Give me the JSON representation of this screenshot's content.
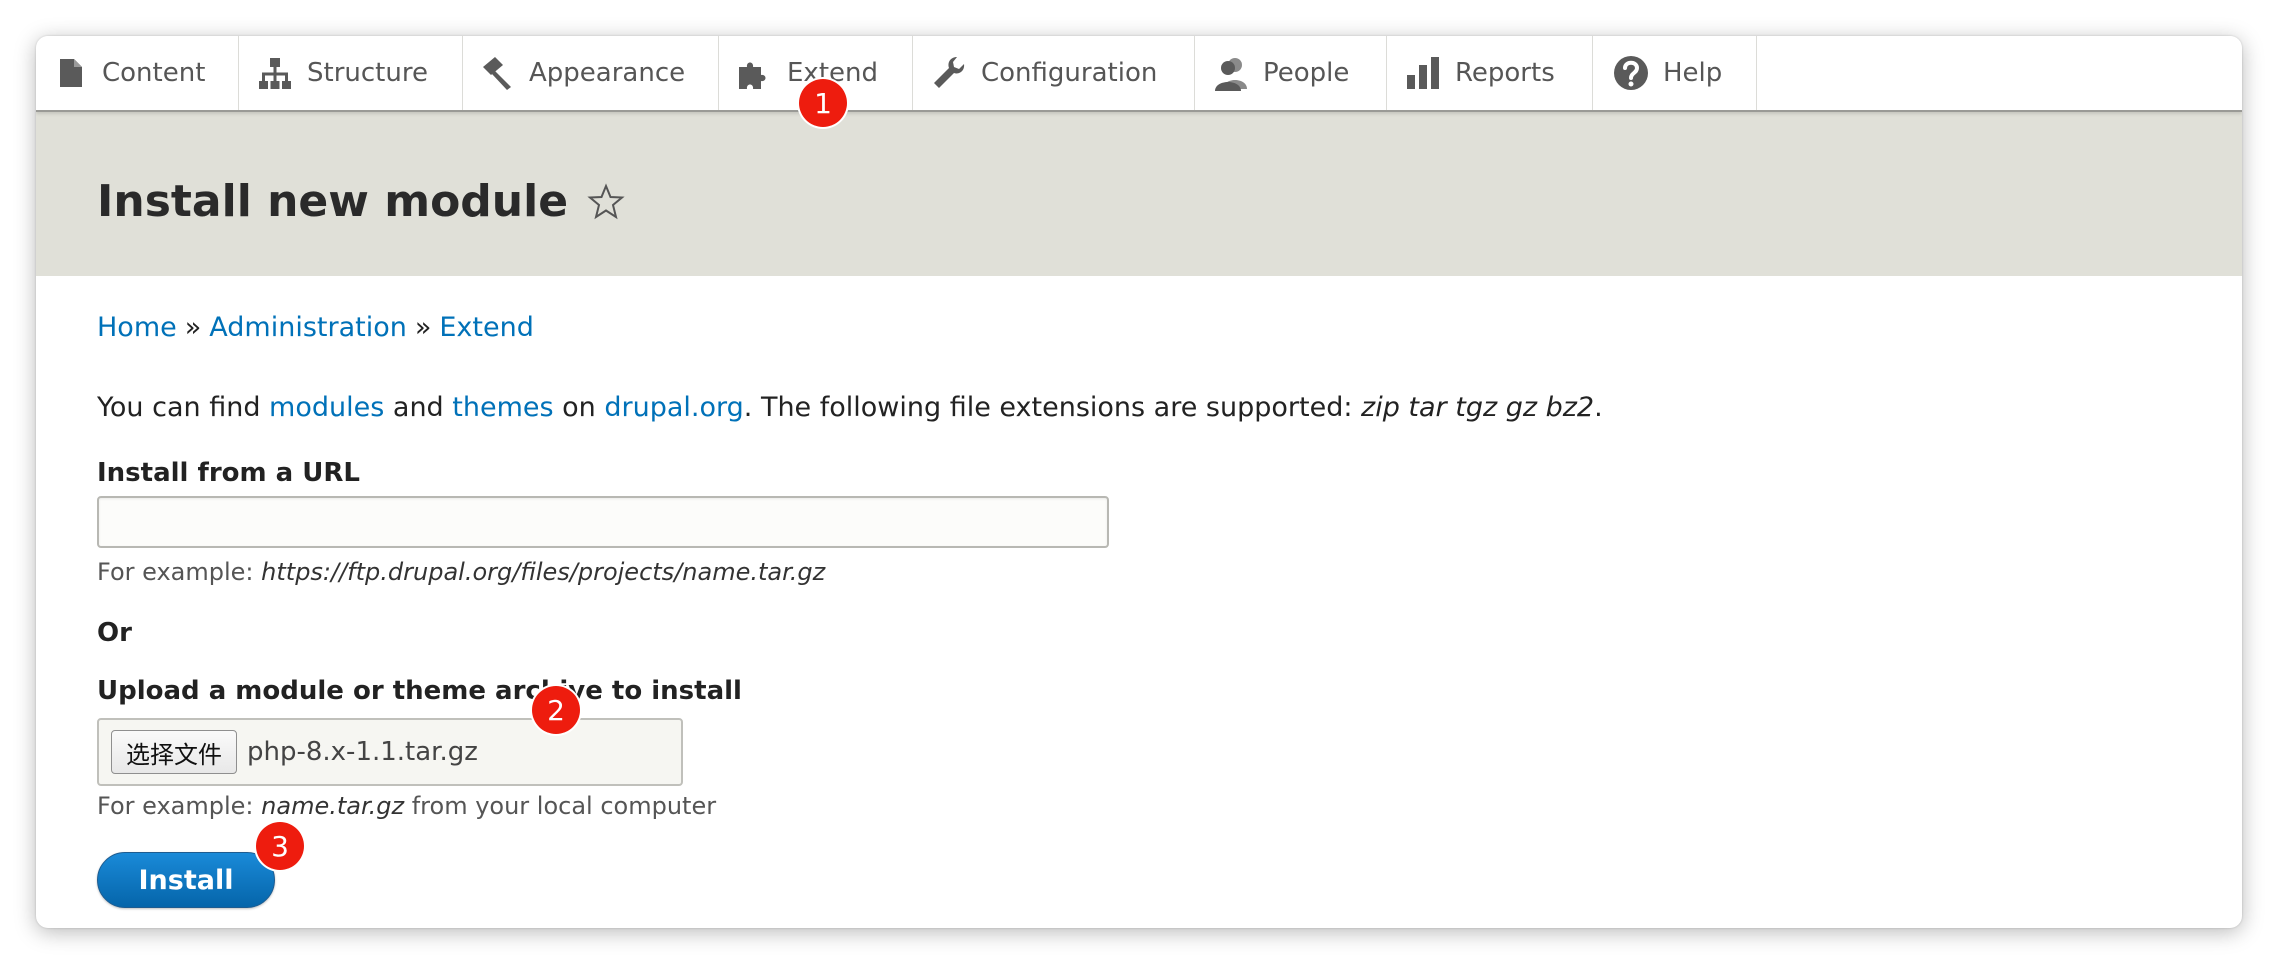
{
  "toolbar": {
    "items": [
      {
        "label": "Content",
        "icon": "document-icon"
      },
      {
        "label": "Structure",
        "icon": "sitemap-icon"
      },
      {
        "label": "Appearance",
        "icon": "paint-brush-icon"
      },
      {
        "label": "Extend",
        "icon": "puzzle-icon"
      },
      {
        "label": "Configuration",
        "icon": "wrench-icon"
      },
      {
        "label": "People",
        "icon": "people-icon"
      },
      {
        "label": "Reports",
        "icon": "bar-chart-icon"
      },
      {
        "label": "Help",
        "icon": "help-icon"
      }
    ]
  },
  "page": {
    "title": "Install new module"
  },
  "breadcrumb": {
    "items": [
      "Home",
      "Administration",
      "Extend"
    ],
    "separator": "»"
  },
  "intro": {
    "prefix": "You can find ",
    "link_modules": "modules",
    "and": " and ",
    "link_themes": "themes",
    "on": " on ",
    "link_drupal": "drupal.org",
    "middle": ". The following file extensions are supported: ",
    "extensions": "zip tar tgz gz bz2",
    "suffix": "."
  },
  "url_field": {
    "label": "Install from a URL",
    "value": "",
    "description_prefix": "For example: ",
    "description_example": "https://ftp.drupal.org/files/projects/name.tar.gz"
  },
  "or_text": "Or",
  "upload_field": {
    "label": "Upload a module or theme archive to install",
    "button_label": "选择文件",
    "file_name": "php-8.x-1.1.tar.gz",
    "description_prefix": "For example: ",
    "description_example": "name.tar.gz",
    "description_suffix": " from your local computer"
  },
  "install_button": {
    "label": "Install"
  },
  "markers": [
    "1",
    "2",
    "3"
  ],
  "colors": {
    "link": "#0071b8",
    "header_band": "#e0e0d8",
    "install_button": "#0a6fbd",
    "marker": "#ee1c0e"
  }
}
